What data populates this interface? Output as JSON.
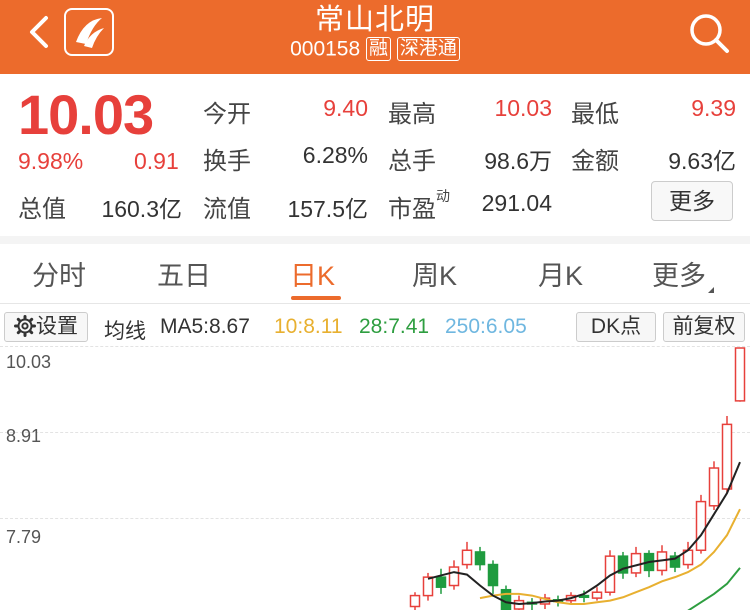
{
  "header": {
    "title": "常山北明",
    "code": "000158",
    "tag_margin": "融",
    "tag_connect": "深港通"
  },
  "quote": {
    "price": "10.03",
    "change_pct": "9.98%",
    "change_val": "0.91",
    "open_label": "今开",
    "open": "9.40",
    "high_label": "最高",
    "high": "10.03",
    "low_label": "最低",
    "low": "9.39",
    "turnover_label": "换手",
    "turnover": "6.28%",
    "volume_label": "总手",
    "volume": "98.6万",
    "amount_label": "金额",
    "amount": "9.63亿",
    "mktcap_label": "总值",
    "mktcap": "160.3亿",
    "float_label": "流值",
    "float": "157.5亿",
    "pe_label": "市盈",
    "pe_sup": "动",
    "pe": "291.04",
    "more_label": "更多"
  },
  "tabs": [
    "分时",
    "五日",
    "日K",
    "周K",
    "月K",
    "更多"
  ],
  "active_tab": "日K",
  "ma_bar": {
    "settings_label": "设置",
    "ma_label": "均线",
    "ma5": "MA5:8.67",
    "ma10": "10:8.11",
    "ma28": "28:7.41",
    "ma250": "250:6.05",
    "dk_label": "DK点",
    "adjust_label": "前复权"
  },
  "colors": {
    "brand": "#ec6b2c",
    "up": "#e7403b",
    "down": "#1f9b3f",
    "ma10": "#e8b030",
    "ma28": "#2e9e40",
    "ma250": "#6fb7e0"
  },
  "chart_data": {
    "type": "candlestick",
    "y_ticks": [
      "10.03",
      "8.91",
      "7.79"
    ],
    "ylim": [
      7.0,
      10.03
    ],
    "candles": [
      {
        "o": 6.95,
        "c": 7.08,
        "h": 7.12,
        "l": 6.9
      },
      {
        "o": 7.08,
        "c": 7.3,
        "h": 7.35,
        "l": 7.02
      },
      {
        "o": 7.3,
        "c": 7.18,
        "h": 7.4,
        "l": 7.1
      },
      {
        "o": 7.2,
        "c": 7.42,
        "h": 7.5,
        "l": 7.15
      },
      {
        "o": 7.45,
        "c": 7.62,
        "h": 7.72,
        "l": 7.4
      },
      {
        "o": 7.6,
        "c": 7.45,
        "h": 7.66,
        "l": 7.38
      },
      {
        "o": 7.45,
        "c": 7.2,
        "h": 7.5,
        "l": 7.1
      },
      {
        "o": 7.15,
        "c": 6.9,
        "h": 7.2,
        "l": 6.8
      },
      {
        "o": 6.92,
        "c": 7.02,
        "h": 7.08,
        "l": 6.85
      },
      {
        "o": 7.0,
        "c": 6.98,
        "h": 7.05,
        "l": 6.9
      },
      {
        "o": 6.98,
        "c": 7.05,
        "h": 7.1,
        "l": 6.92
      },
      {
        "o": 7.03,
        "c": 7.01,
        "h": 7.08,
        "l": 6.95
      },
      {
        "o": 7.02,
        "c": 7.08,
        "h": 7.12,
        "l": 6.98
      },
      {
        "o": 7.08,
        "c": 7.06,
        "h": 7.14,
        "l": 7.0
      },
      {
        "o": 7.05,
        "c": 7.12,
        "h": 7.18,
        "l": 7.02
      },
      {
        "o": 7.12,
        "c": 7.55,
        "h": 7.62,
        "l": 7.08
      },
      {
        "o": 7.55,
        "c": 7.35,
        "h": 7.6,
        "l": 7.28
      },
      {
        "o": 7.35,
        "c": 7.58,
        "h": 7.66,
        "l": 7.3
      },
      {
        "o": 7.58,
        "c": 7.38,
        "h": 7.62,
        "l": 7.3
      },
      {
        "o": 7.38,
        "c": 7.6,
        "h": 7.68,
        "l": 7.32
      },
      {
        "o": 7.55,
        "c": 7.42,
        "h": 7.6,
        "l": 7.36
      },
      {
        "o": 7.45,
        "c": 7.62,
        "h": 7.72,
        "l": 7.4
      },
      {
        "o": 7.62,
        "c": 8.2,
        "h": 8.28,
        "l": 7.58
      },
      {
        "o": 8.15,
        "c": 8.6,
        "h": 8.68,
        "l": 8.1
      },
      {
        "o": 8.35,
        "c": 9.12,
        "h": 9.22,
        "l": 8.3
      },
      {
        "o": 9.4,
        "c": 10.03,
        "h": 10.03,
        "l": 9.39
      }
    ],
    "ma5": [
      7.28,
      7.32,
      7.36,
      7.33,
      7.2,
      7.08,
      7.0,
      6.98,
      6.99,
      7.01,
      7.02,
      7.05,
      7.1,
      7.2,
      7.32,
      7.4,
      7.44,
      7.48,
      7.5,
      7.52,
      7.62,
      7.8,
      8.05,
      8.3,
      8.67
    ],
    "ma10": [
      7.05,
      7.08,
      7.1,
      7.1,
      7.08,
      7.04,
      7.0,
      6.98,
      6.98,
      7.0,
      7.02,
      7.06,
      7.12,
      7.18,
      7.25,
      7.3,
      7.36,
      7.45,
      7.6,
      7.8,
      8.11
    ],
    "ma28": [
      6.62,
      6.66,
      6.72,
      6.8,
      6.9,
      7.0,
      7.1,
      7.22,
      7.41
    ]
  }
}
